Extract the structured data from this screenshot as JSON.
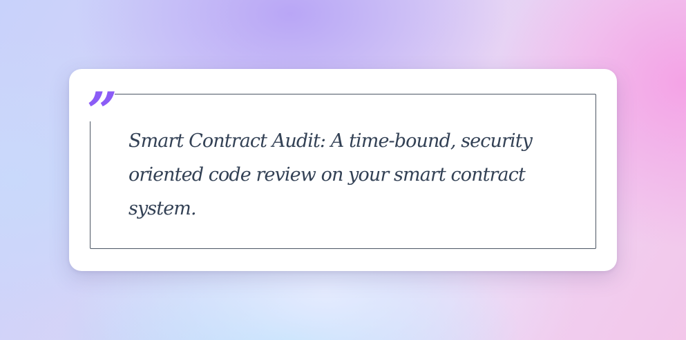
{
  "quote": {
    "mark": "”",
    "text": "Smart Contract Audit: A time-bound, security oriented code review on your smart contract system."
  },
  "colors": {
    "accent": "#8b5cf6",
    "text": "#334155",
    "frame": "#4b5563",
    "card": "#ffffff"
  },
  "icons": {
    "quote_mark": "quote-mark-icon"
  }
}
